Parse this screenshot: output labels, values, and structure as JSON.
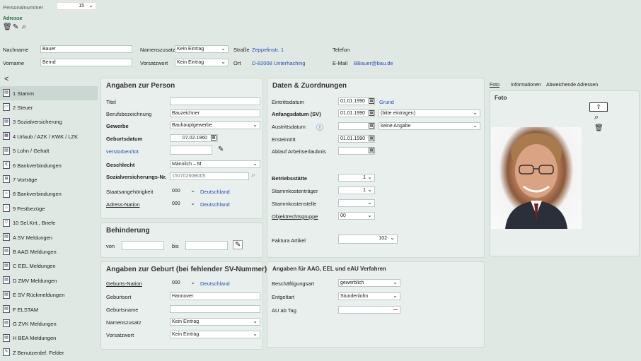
{
  "topbar": {
    "personnel_label": "Personalnummer",
    "personnel_value": "15"
  },
  "address": {
    "section_label": "Adresse",
    "icons": [
      "trash-icon",
      "edit-icon",
      "search-icon"
    ]
  },
  "header": {
    "lastname_label": "Nachname",
    "lastname_value": "Bauer",
    "firstname_label": "Vorname",
    "firstname_value": "Bernd",
    "name_suffix_label": "Namenszusatz",
    "name_suffix_value": "Kein Eintrag",
    "prefix_label": "Vorsatzwort",
    "prefix_value": "Kein Eintrag",
    "street_label": "Straße",
    "street_value": "Zeppelinstr. 1",
    "city_label": "Ort",
    "city_value": "D-82008 Unterhaching",
    "phone_label": "Telefon",
    "phone_value": "",
    "email_label": "E-Mail",
    "email_value": "BBauer@bau.de"
  },
  "sidebar": {
    "collapse": "<",
    "items": [
      {
        "label": "1 Stamm",
        "icon": "person-card-icon",
        "active": true
      },
      {
        "label": "2 Steuer",
        "icon": "tax-icon"
      },
      {
        "label": "3 Sozialversicherung",
        "icon": "document-icon"
      },
      {
        "label": "4 Urlaub / AZK / KWK / LZK",
        "icon": "calendar-icon"
      },
      {
        "label": "5 Lohn / Gehalt",
        "icon": "document-icon"
      },
      {
        "label": "6 Bankverbindungen",
        "icon": "euro-icon"
      },
      {
        "label": "7 Vorträge",
        "icon": "grid-icon"
      },
      {
        "label": "8 Bankverbindungen",
        "icon": "bank-icon"
      },
      {
        "label": "9 Festbezüge",
        "icon": "bank-icon"
      },
      {
        "label": "10 Sel.Krit., Briefe",
        "icon": "filter-icon"
      },
      {
        "label": "A SV Meldungen",
        "icon": "document-icon"
      },
      {
        "label": "B AAG Meldungen",
        "icon": "document-icon"
      },
      {
        "label": "C EEL Meldungen",
        "icon": "document-icon"
      },
      {
        "label": "D ZMV Meldungen",
        "icon": "document-icon"
      },
      {
        "label": "E SV Rückmeldungen",
        "icon": "document-icon"
      },
      {
        "label": "F ELSTAM",
        "icon": "document-icon"
      },
      {
        "label": "G ZVK Meldungen",
        "icon": "document-icon"
      },
      {
        "label": "H BEA Meldungen",
        "icon": "document-icon"
      },
      {
        "label": "Z Benutzerdef. Felder",
        "icon": "edit-doc-icon"
      }
    ]
  },
  "person": {
    "title": "Angaben zur Person",
    "titel_label": "Titel",
    "titel_value": "",
    "job_label": "Berufsbezeichnung",
    "job_value": "Bauzeichner",
    "trade_label": "Gewerbe",
    "trade_value": "Bauhauptgewerbe",
    "birth_label": "Geburtsdatum",
    "birth_value": "07.02.1960",
    "deceased_label": "verstorben/tot",
    "deceased_value": "",
    "gender_label": "Geschlecht",
    "gender_value": "Männlich – M",
    "svnr_label": "Sozialversicherungs-Nr.",
    "svnr_value": "15070260B005",
    "nationality_label": "Staatsangehörigkeit",
    "nationality_code": "000",
    "nationality_name": "Deutschland",
    "addrnation_label": "Adress-Nation",
    "addrnation_code": "000",
    "addrnation_name": "Deutschland"
  },
  "disability": {
    "title": "Behinderung",
    "from_label": "von",
    "to_label": "bis"
  },
  "birthinfo": {
    "title": "Angaben zur Geburt (bei fehlender SV-Nummer)",
    "nation_label": "Geburts-Nation",
    "nation_code": "000",
    "nation_name": "Deutschland",
    "place_label": "Geburtsort",
    "place_value": "Hannover",
    "name_label": "Geburtsname",
    "name_value": "",
    "suffix_label": "Namenszusatz",
    "suffix_value": "Kein Eintrag",
    "prefix_label": "Vorsatzwort",
    "prefix_value": "Kein Eintrag"
  },
  "data": {
    "title": "Daten & Zuordnungen",
    "entry_label": "Eintrittsdatum",
    "entry_value": "01.01.1990",
    "entry_reason": "Grund",
    "start_label": "Anfangsdatum (SV)",
    "start_value": "01.01.1990",
    "start_reason": "(bitte eintragen)",
    "exit_label": "Austrittsdatum",
    "exit_value": "",
    "exit_reason": "keine Angabe",
    "first_label": "Ersteintritt",
    "first_value": "01.01.1990",
    "lastday_label": "Ablauf Arbeitserlaubnis",
    "lastday_value": "",
    "site_label": "Betriebsstätte",
    "site_value": "1",
    "cost1_label": "Stammkostenträger",
    "cost1_value": "1",
    "cost2_label": "Stammkostenstelle",
    "cost2_value": "",
    "group_label": "Objektrechtsgruppe",
    "group_value": "00",
    "factor_label": "Faktura Artikel",
    "factor_value": "102"
  },
  "aag": {
    "title": "Angaben für AAG, EEL und eAU Verfahren",
    "employment_label": "Beschäftigungsart",
    "employment_value": "gewerblich",
    "pay_label": "Entgeltart",
    "pay_value": "Stundenlohn",
    "au_label": "AU ab Tag",
    "au_value": ""
  },
  "photo": {
    "tabs": [
      "Foto",
      "Informationen",
      "Abweichende Adressen"
    ],
    "title": "Foto"
  },
  "colors": {
    "bg": "#dfe8e3",
    "panel": "#e9efec",
    "link": "#2a4fb8",
    "error": "#d33"
  }
}
